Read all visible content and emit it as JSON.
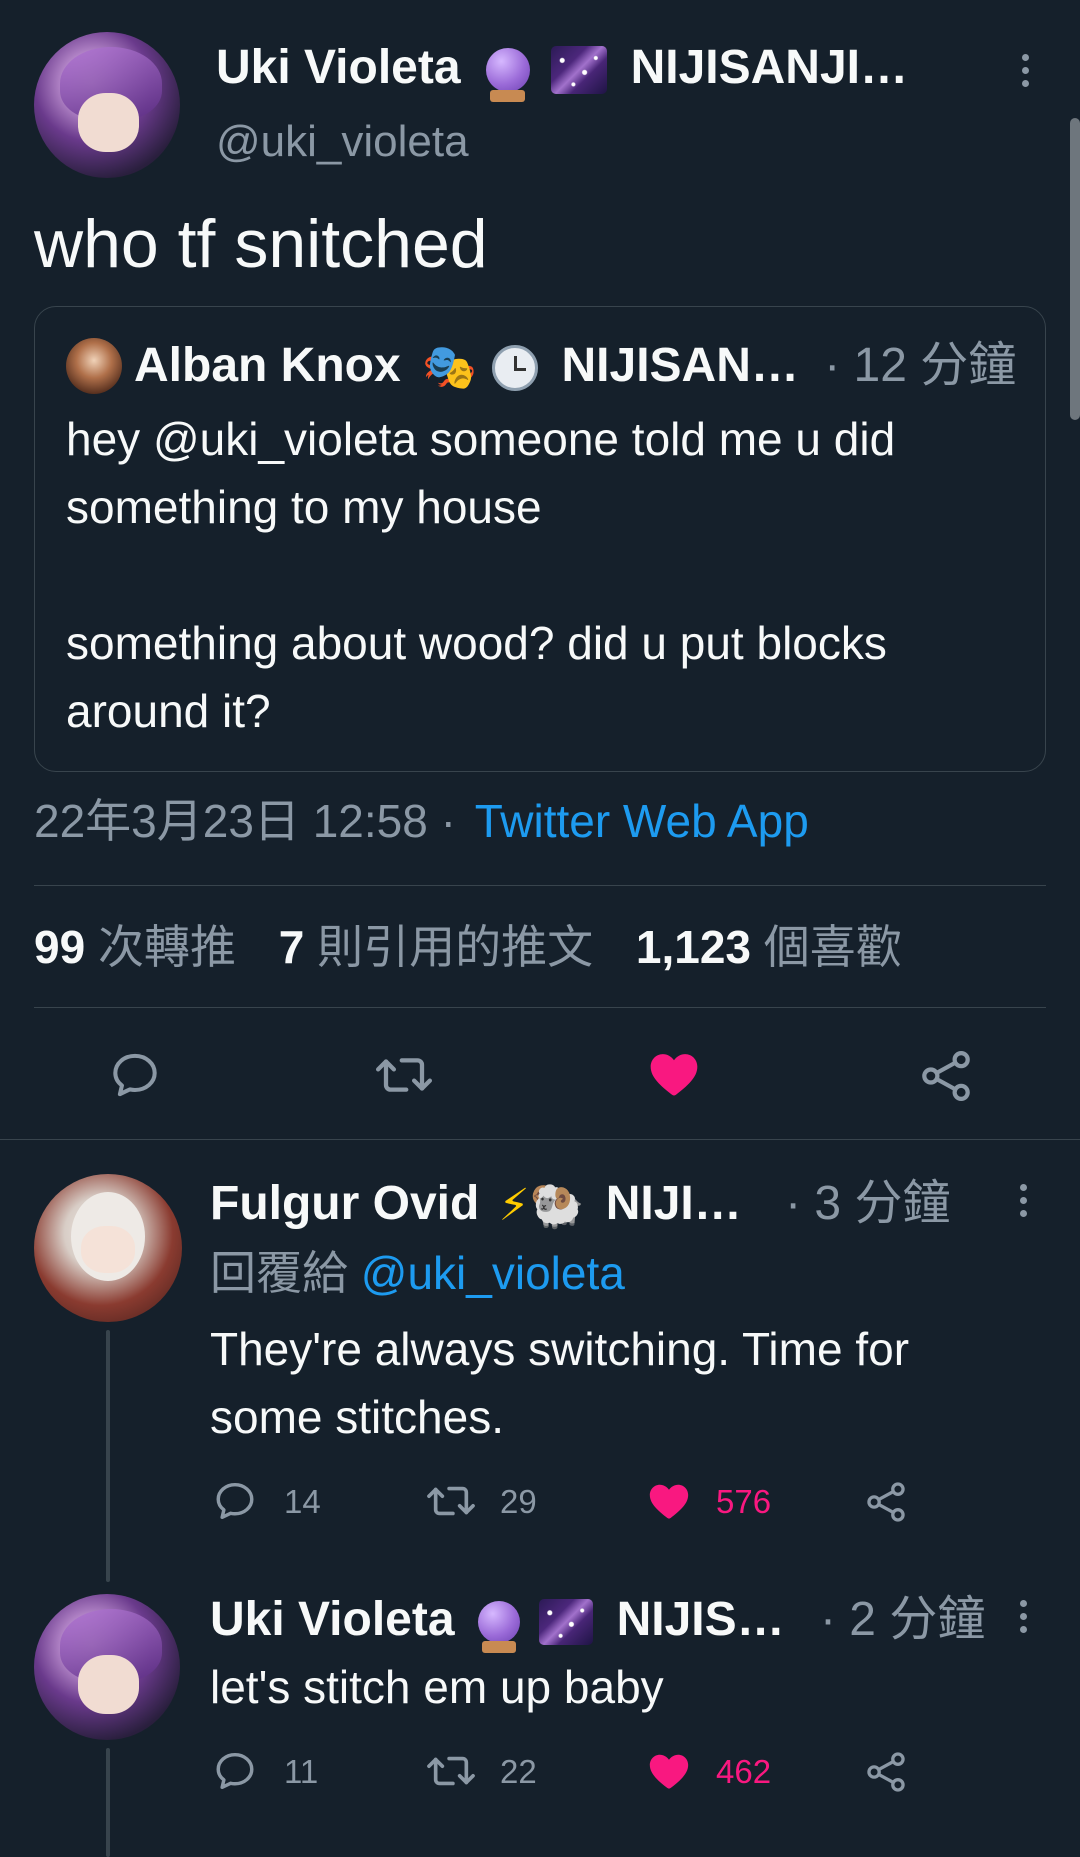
{
  "main_tweet": {
    "author_name": "Uki Violeta",
    "author_suffix": "NIJISANJI…",
    "author_handle": "@uki_violeta",
    "author_emojis": [
      "crystal-ball",
      "milky-way"
    ],
    "text": "who tf snitched",
    "quoted": {
      "author_name": "Alban Knox",
      "author_suffix": "NIJISAN…",
      "author_emojis": [
        "performing-arts",
        "clock"
      ],
      "time": "· 12 分鐘",
      "line1": "hey @uki_violeta someone told me u did",
      "line2": "something to my house",
      "line3": "something about wood? did u put blocks",
      "line4": "around it?"
    },
    "timestamp": "22年3月23日 12:58 ·",
    "source": "Twitter Web App",
    "stats": {
      "retweets_count": "99",
      "retweets_label": "次轉推",
      "quotes_count": "7",
      "quotes_label": "則引用的推文",
      "likes_count": "1,123",
      "likes_label": "個喜歡"
    },
    "liked": true
  },
  "replies": [
    {
      "author_name": "Fulgur Ovid",
      "author_suffix": "NIJI…",
      "author_emojis": [
        "high-voltage",
        "ram"
      ],
      "time": "· 3 分鐘",
      "reply_prefix": "回覆給",
      "reply_to": "@uki_violeta",
      "line1": "They're always switching. Time for",
      "line2": "some stitches.",
      "replies": "14",
      "retweets": "29",
      "likes": "576"
    },
    {
      "author_name": "Uki Violeta",
      "author_suffix": "NIJIS…",
      "author_emojis": [
        "crystal-ball",
        "milky-way"
      ],
      "time": "· 2 分鐘",
      "line1": "let's stitch em up baby",
      "replies": "11",
      "retweets": "22",
      "likes": "462"
    }
  ],
  "colors": {
    "background": "#15202b",
    "text": "#f7f9f9",
    "muted": "#8b98a5",
    "link": "#1d9bf0",
    "like": "#f91880",
    "border": "#38444d"
  }
}
